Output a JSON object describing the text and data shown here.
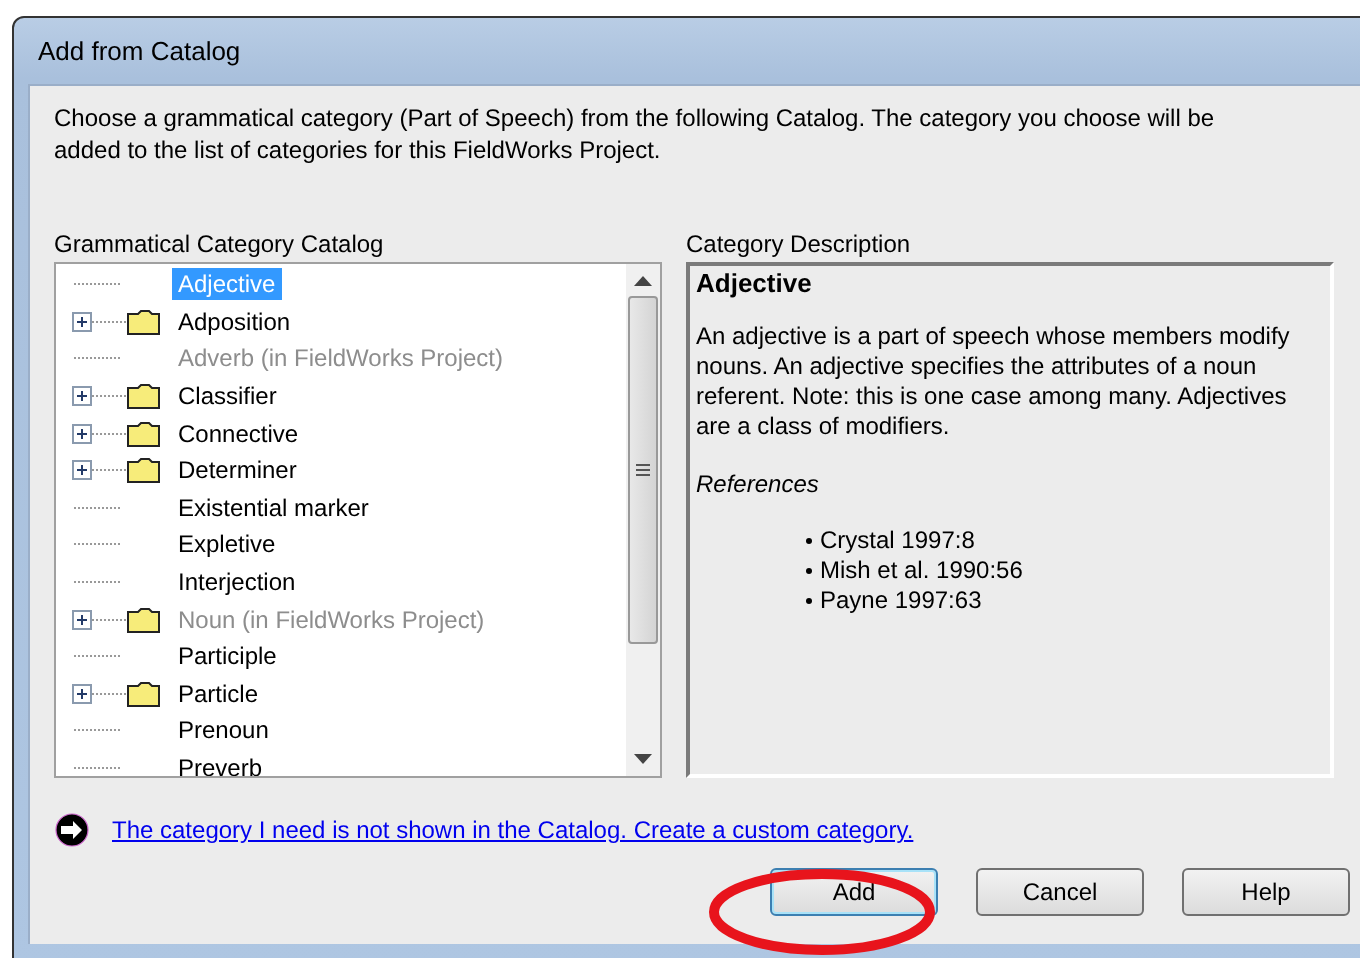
{
  "window": {
    "title": "Add from Catalog"
  },
  "instructions": "Choose a grammatical category (Part of Speech) from the following Catalog. The category you choose will be added to the list of categories for this FieldWorks Project.",
  "catalog": {
    "label": "Grammatical Category Catalog",
    "items": [
      {
        "label": "Adjective",
        "kind": "leaf",
        "selected": true,
        "disabled": false
      },
      {
        "label": "Adposition",
        "kind": "folder",
        "selected": false,
        "disabled": false
      },
      {
        "label": "Adverb (in FieldWorks Project)",
        "kind": "leaf",
        "selected": false,
        "disabled": true
      },
      {
        "label": "Classifier",
        "kind": "folder",
        "selected": false,
        "disabled": false
      },
      {
        "label": "Connective",
        "kind": "folder",
        "selected": false,
        "disabled": false
      },
      {
        "label": "Determiner",
        "kind": "folder",
        "selected": false,
        "disabled": false
      },
      {
        "label": "Existential marker",
        "kind": "leaf",
        "selected": false,
        "disabled": false
      },
      {
        "label": "Expletive",
        "kind": "leaf",
        "selected": false,
        "disabled": false
      },
      {
        "label": "Interjection",
        "kind": "leaf",
        "selected": false,
        "disabled": false
      },
      {
        "label": "Noun (in FieldWorks Project)",
        "kind": "folder",
        "selected": false,
        "disabled": true
      },
      {
        "label": "Participle",
        "kind": "leaf",
        "selected": false,
        "disabled": false
      },
      {
        "label": "Particle",
        "kind": "folder",
        "selected": false,
        "disabled": false
      },
      {
        "label": "Prenoun",
        "kind": "leaf",
        "selected": false,
        "disabled": false
      },
      {
        "label": "Preverb",
        "kind": "leaf",
        "selected": false,
        "disabled": false
      }
    ]
  },
  "description": {
    "label": "Category Description",
    "heading": "Adjective",
    "body": "An adjective is a part of speech whose members modify nouns. An adjective specifies the attributes of a noun referent. Note: this is one case among many. Adjectives are a class of modifiers.",
    "references_heading": "References",
    "references": [
      "Crystal 1997:8",
      "Mish et al. 1990:56",
      "Payne 1997:63"
    ]
  },
  "custom_link": "The category I need is not shown in the Catalog. Create a custom category.",
  "buttons": [
    {
      "label": "Add",
      "default": true
    },
    {
      "label": "Cancel",
      "default": false
    },
    {
      "label": "Help",
      "default": false
    }
  ]
}
